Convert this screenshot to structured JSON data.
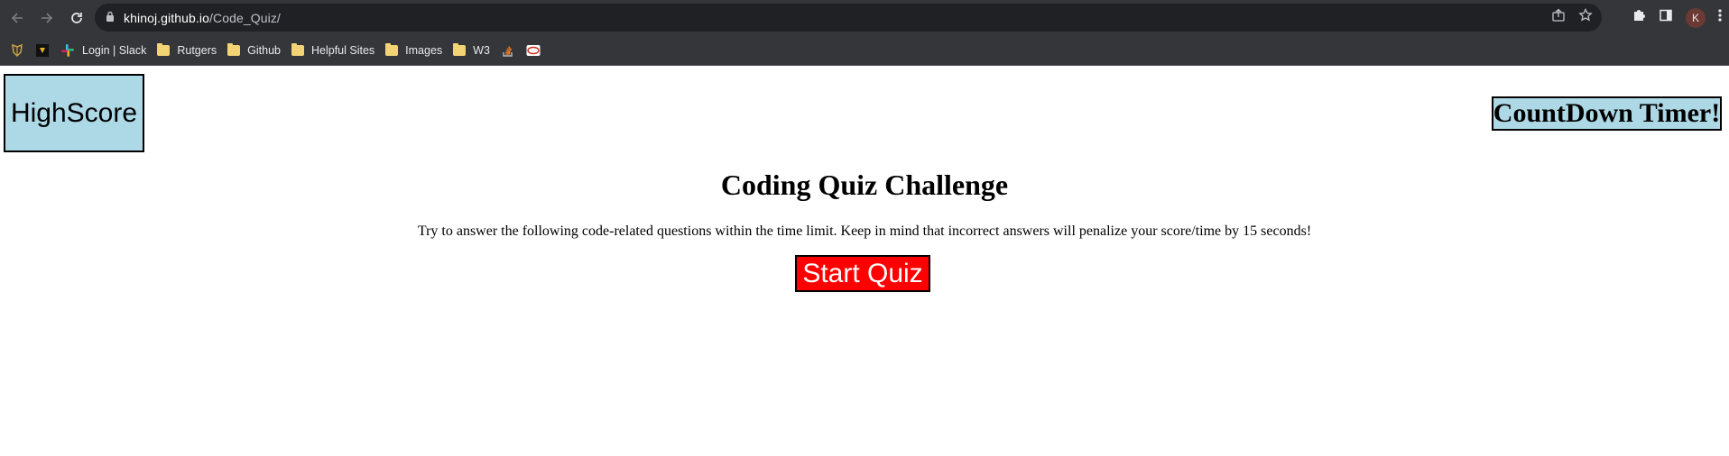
{
  "browser": {
    "url_host": "khinoj.github.io",
    "url_path": "/Code_Quiz/",
    "profile_initial": "K",
    "bookmarks": [
      {
        "label": "",
        "icon": "shield-logo-icon"
      },
      {
        "label": "",
        "icon": "dark-square-logo-icon"
      },
      {
        "label": "Login | Slack",
        "icon": "slack-icon"
      },
      {
        "label": "Rutgers",
        "icon": "folder-icon"
      },
      {
        "label": "Github",
        "icon": "folder-icon"
      },
      {
        "label": "Helpful Sites",
        "icon": "folder-icon"
      },
      {
        "label": "Images",
        "icon": "folder-icon"
      },
      {
        "label": "W3",
        "icon": "folder-icon"
      },
      {
        "label": "",
        "icon": "stackoverflow-icon"
      },
      {
        "label": "",
        "icon": "adp-icon"
      }
    ]
  },
  "page": {
    "highscore_label": "HighScore",
    "timer_label": "CountDown Timer!",
    "title": "Coding Quiz Challenge",
    "intro": "Try to answer the following code-related questions within the time limit. Keep in mind that incorrect answers will penalize your score/time by 15 seconds!",
    "start_label": "Start Quiz"
  },
  "colors": {
    "highscore_bg": "#add8e6",
    "timer_bg": "#add8e6",
    "start_bg": "#ff0000"
  }
}
